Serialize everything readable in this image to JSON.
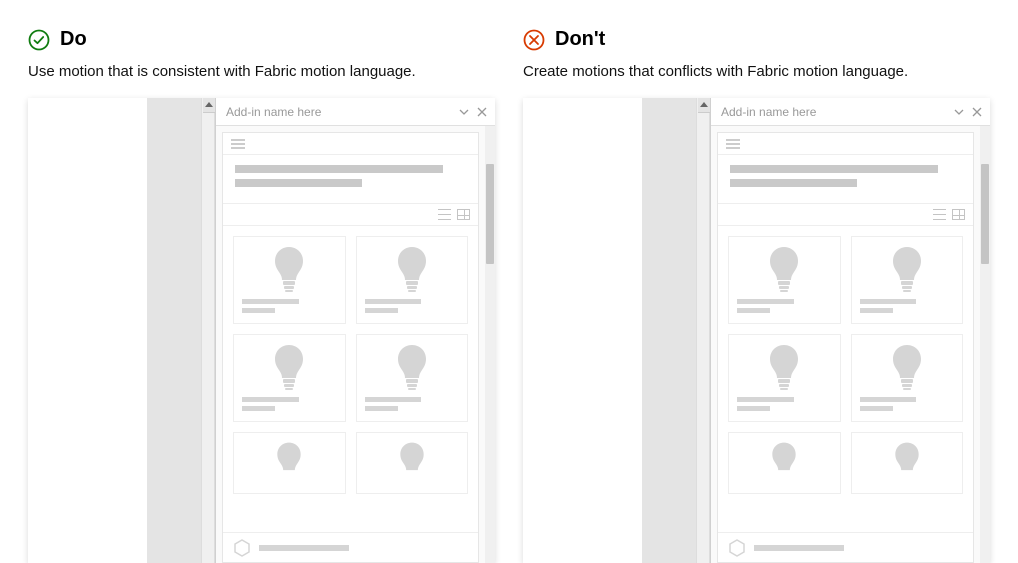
{
  "do": {
    "label": "Do",
    "description": "Use motion that is consistent with Fabric motion language.",
    "icon_color": "#107c10"
  },
  "dont": {
    "label": "Don't",
    "description": "Create motions that conflicts with Fabric motion language.",
    "icon_color": "#d83b01"
  },
  "addin": {
    "title": "Add-in name here"
  }
}
